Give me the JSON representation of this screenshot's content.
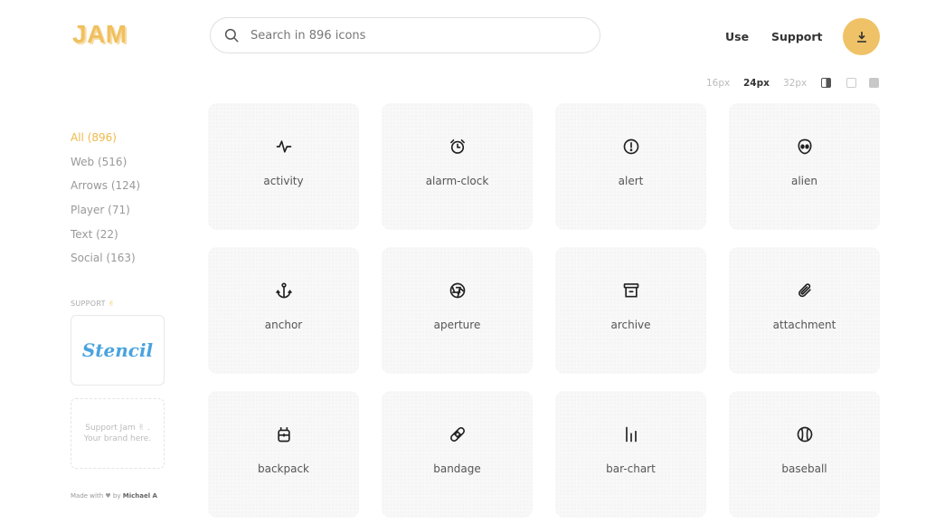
{
  "brand": {
    "logo": "JAM",
    "accent": "#f0c267"
  },
  "search": {
    "placeholder": "Search in 896 icons",
    "value": ""
  },
  "nav": {
    "use": "Use",
    "support": "Support",
    "download_icon": "download-icon"
  },
  "size_options": {
    "s16": "16px",
    "s24": "24px",
    "s32": "32px",
    "selected": "24px"
  },
  "view_modes": [
    "half",
    "outline",
    "filled"
  ],
  "categories": [
    {
      "label": "All (896)",
      "active": true
    },
    {
      "label": "Web (516)",
      "active": false
    },
    {
      "label": "Arrows (124)",
      "active": false
    },
    {
      "label": "Player (71)",
      "active": false
    },
    {
      "label": "Text (22)",
      "active": false
    },
    {
      "label": "Social (163)",
      "active": false
    }
  ],
  "support": {
    "label": "SUPPORT",
    "emoji": "✌",
    "stencil": "Stencil",
    "jam_ad": "Support Jam ✌ .\nYour brand here.",
    "made_with_prefix": "Made with",
    "heart": "♥",
    "by": "by",
    "author": "Michael A"
  },
  "icons": [
    {
      "name": "activity",
      "icon": "activity-icon"
    },
    {
      "name": "alarm-clock",
      "icon": "alarm-clock-icon"
    },
    {
      "name": "alert",
      "icon": "alert-icon"
    },
    {
      "name": "alien",
      "icon": "alien-icon"
    },
    {
      "name": "anchor",
      "icon": "anchor-icon"
    },
    {
      "name": "aperture",
      "icon": "aperture-icon"
    },
    {
      "name": "archive",
      "icon": "archive-icon"
    },
    {
      "name": "attachment",
      "icon": "attachment-icon"
    },
    {
      "name": "backpack",
      "icon": "backpack-icon"
    },
    {
      "name": "bandage",
      "icon": "bandage-icon"
    },
    {
      "name": "bar-chart",
      "icon": "bar-chart-icon"
    },
    {
      "name": "baseball",
      "icon": "baseball-icon"
    }
  ]
}
